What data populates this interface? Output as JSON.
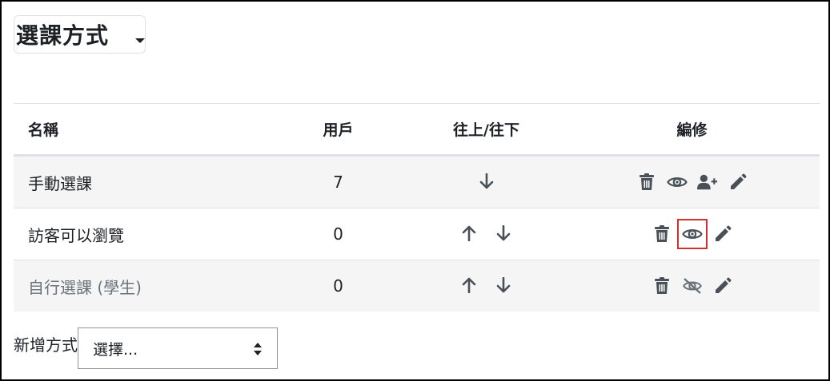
{
  "heading": {
    "title": "選課方式"
  },
  "table": {
    "headers": {
      "name": "名稱",
      "users": "用戶",
      "move": "往上/往下",
      "edit": "編修"
    },
    "rows": [
      {
        "name": "手動選課",
        "users": "7",
        "hidden": false,
        "move": [
          "down"
        ],
        "actions": [
          "delete-icon",
          "eye-icon",
          "enrol-users-icon",
          "edit-icon"
        ]
      },
      {
        "name": "訪客可以瀏覽",
        "users": "0",
        "hidden": false,
        "move": [
          "up",
          "down"
        ],
        "actions": [
          "delete-icon",
          "eye-icon",
          "edit-icon"
        ],
        "highlighted_action": "eye-icon"
      },
      {
        "name": "自行選課 (學生)",
        "users": "0",
        "hidden": true,
        "move": [
          "up",
          "down"
        ],
        "actions": [
          "delete-icon",
          "eye-slash-icon",
          "edit-icon"
        ]
      }
    ]
  },
  "add_method": {
    "label": "新增方式",
    "select_value": "選擇..."
  },
  "colors": {
    "icon": "#495057",
    "highlight": "#d62d2d",
    "muted_text": "#6a737b",
    "stripe": "#f5f5f5"
  }
}
